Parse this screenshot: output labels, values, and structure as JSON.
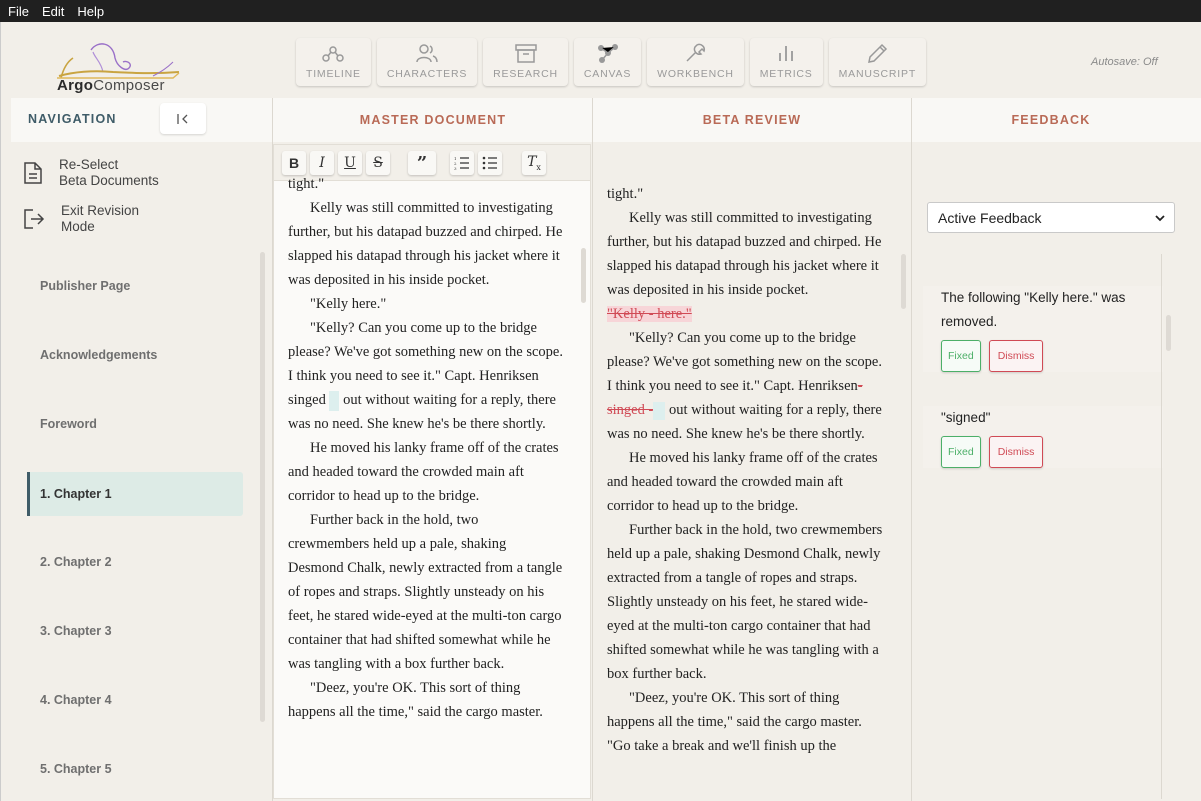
{
  "menu": [
    "File",
    "Edit",
    "Help"
  ],
  "logo": {
    "bold": "Argo",
    "rest": "Composer"
  },
  "toolbar": [
    {
      "label": "TIMELINE",
      "icon": "timeline-icon"
    },
    {
      "label": "CHARACTERS",
      "icon": "characters-icon"
    },
    {
      "label": "RESEARCH",
      "icon": "research-icon"
    },
    {
      "label": "CANVAS",
      "icon": "canvas-icon"
    },
    {
      "label": "WORKBENCH",
      "icon": "workbench-icon"
    },
    {
      "label": "METRICS",
      "icon": "metrics-icon"
    },
    {
      "label": "MANUSCRIPT",
      "icon": "manuscript-icon"
    }
  ],
  "autosave": "Autosave: Off",
  "columns": {
    "navigation": "NAVIGATION",
    "master": "MASTER DOCUMENT",
    "beta": "BETA REVIEW",
    "feedback": "FEEDBACK"
  },
  "sidebar": {
    "actions": [
      {
        "line1": "Re-Select",
        "line2": "Beta Documents"
      },
      {
        "line1": "Exit Revision",
        "line2": "Mode"
      }
    ],
    "items": [
      "Publisher Page",
      "Acknowledgements",
      "Foreword",
      "1. Chapter 1",
      "2. Chapter 2",
      "3. Chapter 3",
      "4. Chapter 4",
      "5. Chapter 5"
    ],
    "active_index": 3
  },
  "master": {
    "p0": "tight.\"",
    "p1": "Kelly was still committed to investigating further, but his datapad buzzed and chirped. He slapped his datapad through his jacket where it was deposited in his inside pocket.",
    "p2": "\"Kelly here.\"",
    "p3a": "\"Kelly? Can you come up to the bridge please? We've got something new on the scope. I think you need to see it.\" Capt. Henriksen singed",
    "p3b": "out without waiting for a reply, there was no need. She knew he's be there shortly.",
    "p4": "He moved his lanky frame off of the crates and headed toward the crowded main aft corridor to head up to the bridge.",
    "p5": "Further back in the hold, two crewmembers held up a pale, shaking Desmond Chalk, newly extracted from a tangle of ropes and straps. Slightly unsteady on his feet, he stared wide-eyed at the multi-ton cargo container that had shifted somewhat while he was tangling with a box further back.",
    "p6": "\"Deez, you're OK. This sort of thing happens all the time,\" said the cargo master."
  },
  "beta": {
    "p0": "tight.\"",
    "p1": "Kelly was still committed to investigating further, but his datapad buzzed and chirped. He slapped his datapad through his jacket where it was deposited in his inside pocket.",
    "del1": "\"Kelly - here.\"",
    "p3a": "\"Kelly? Can you come up to the bridge please? We've got something new on the scope. I think you need to see it.\" Capt. Henriksen",
    "del2": "- singed -",
    "p3b": "out without waiting for a reply, there was no need. She knew he's be there shortly.",
    "p4": "He moved his lanky frame off of the crates and headed toward the crowded main aft corridor to head up to the bridge.",
    "p5": "Further back in the hold, two crewmembers held up a pale, shaking Desmond Chalk, newly extracted from a tangle of ropes and straps. Slightly unsteady on his feet, he stared wide-eyed at the multi-ton cargo container that had shifted somewhat while he was tangling with a box further back.",
    "p6": "\"Deez, you're OK. This sort of thing happens all the time,\" said the cargo master. \"Go take a break and we'll finish up the"
  },
  "feedback": {
    "filter": "Active Feedback",
    "cards": [
      {
        "text": "The following \"Kelly here.\" was removed.",
        "fixed": "Fixed",
        "dismiss": "Dismiss"
      },
      {
        "text": "\"signed\"",
        "fixed": "Fixed",
        "dismiss": "Dismiss"
      }
    ]
  }
}
